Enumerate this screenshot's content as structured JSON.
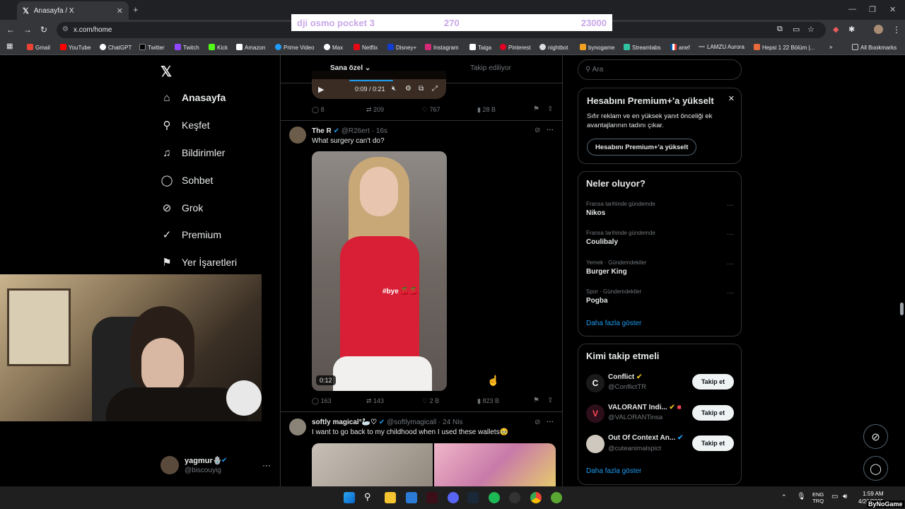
{
  "browser": {
    "tab_title": "Anasayfa / X",
    "url": "x.com/home",
    "bookmarks": [
      "Gmail",
      "YouTube",
      "ChatGPT",
      "Twitter",
      "Twitch",
      "Kick",
      "Amazon",
      "Prime Video",
      "Max",
      "Netflix",
      "Disney+",
      "Instagram",
      "Taiga",
      "Pinterest",
      "nightbot",
      "bynogame",
      "Streamlabs",
      "anef",
      "LAMZU Aurora",
      "Hepsi 1 22 Bölüm |...",
      "All Bookmarks"
    ]
  },
  "overlay": {
    "item": "dji osmo pocket 3",
    "count": "270",
    "price": "23000"
  },
  "nav": {
    "items": [
      {
        "label": "Anasayfa"
      },
      {
        "label": "Keşfet"
      },
      {
        "label": "Bildirimler"
      },
      {
        "label": "Sohbet"
      },
      {
        "label": "Grok"
      },
      {
        "label": "Premium"
      },
      {
        "label": "Yer İşaretleri"
      }
    ],
    "user": {
      "name": "yagmur🪬",
      "handle": "@biscouyig"
    }
  },
  "feed": {
    "tabs": [
      {
        "label": "Sana özel"
      },
      {
        "label": "Takip ediliyor"
      }
    ],
    "prev_video_time": "0:09 / 0:21",
    "prev_actions": {
      "replies": "8",
      "reposts": "209",
      "likes": "767",
      "views": "28 B"
    },
    "tweets": [
      {
        "name": "The R",
        "handle": "@R26ert",
        "time": "16s",
        "text": "What surgery can't do?",
        "media_caption": "#bye 🍒🍒",
        "duration": "0:12",
        "replies": "163",
        "reposts": "143",
        "likes": "2 B",
        "views": "823 B"
      },
      {
        "name": "softly magical°🦢♡",
        "handle": "@softlymagicall",
        "time": "24 Nis",
        "text": "I want to go back to my childhood when I used these wallets🥹"
      }
    ]
  },
  "right": {
    "search_placeholder": "Ara",
    "premium": {
      "title": "Hesabını Premium+'a yükselt",
      "body": "Sıfır reklam ve en yüksek yanıt önceliği ek avantajlarının tadını çıkar.",
      "button": "Hesabını Premium+'a yükselt"
    },
    "trends": {
      "title": "Neler oluyor?",
      "items": [
        {
          "category": "Fransa tarihinde gündemde",
          "name": "Nikos"
        },
        {
          "category": "Fransa tarihinde gündemde",
          "name": "Coulibaly"
        },
        {
          "category": "Yemek · Gündemdekiler",
          "name": "Burger King"
        },
        {
          "category": "Spor · Gündemdekiler",
          "name": "Pogba"
        }
      ],
      "more": "Daha fazla göster"
    },
    "follow": {
      "title": "Kimi takip etmeli",
      "items": [
        {
          "name": "Conflict",
          "handle": "@ConflictTR",
          "button": "Takip et"
        },
        {
          "name": "VALORANT Indi...",
          "handle": "@VALORANTinsa",
          "button": "Takip et"
        },
        {
          "name": "Out Of Context An...",
          "handle": "@cuteanimalspict",
          "button": "Takip et"
        }
      ],
      "more": "Daha fazla göster"
    }
  },
  "taskbar": {
    "lang": "ENG",
    "lang2": "TRQ",
    "time": "1:59 AM",
    "date": "4/26/2025",
    "watermark": "ByNoGame"
  },
  "colors": {
    "accent": "#1d9bf0",
    "verified": "#1d9bf0",
    "gold": "#e2b719"
  }
}
